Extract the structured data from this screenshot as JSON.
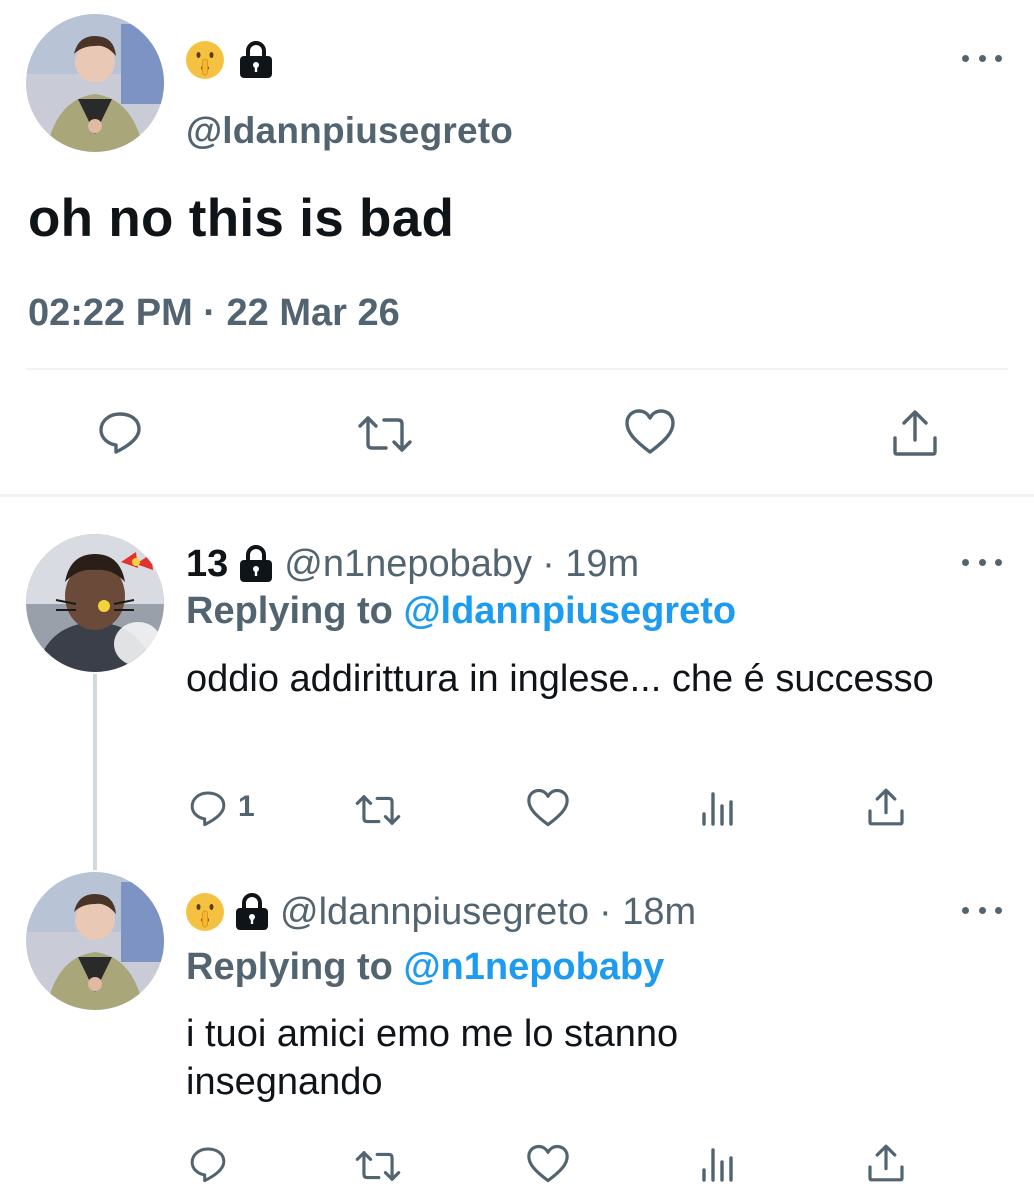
{
  "main_tweet": {
    "display_name_emoji": "shushing-face-emoji",
    "locked": true,
    "handle": "@ldannpiusegreto",
    "text": "oh no this is bad",
    "timestamp": "02:22 PM · 22 Mar 26",
    "actions": [
      "reply-icon",
      "retweet-icon",
      "like-icon",
      "share-icon"
    ]
  },
  "replies": [
    {
      "name": "13",
      "locked": true,
      "handle": "@n1nepobaby",
      "time": "· 19m",
      "replying_label": "Replying to",
      "replying_to": "@ldannpiusegreto",
      "text": "oddio addirittura in inglese... che é successo",
      "reply_count": "1"
    },
    {
      "name": "",
      "name_emoji": "shushing-face-emoji",
      "locked": true,
      "handle": "@ldannpiusegreto",
      "time": "· 18m",
      "replying_label": "Replying to",
      "replying_to": "@n1nepobaby",
      "text": "i tuoi amici emo me lo stanno insegnando",
      "reply_count": ""
    }
  ],
  "colors": {
    "text": "#0f1419",
    "secondary": "#536471",
    "accent": "#1d9bf0",
    "divider": "#eff3f4"
  }
}
